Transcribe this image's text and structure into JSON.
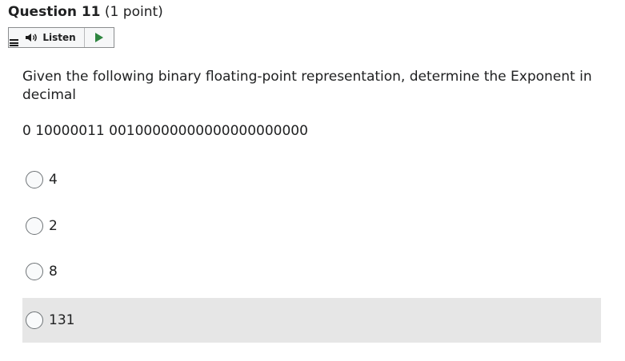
{
  "question": {
    "title": "Question 11",
    "points": "(1 point)",
    "text": "Given the following binary floating-point representation, determine the Exponent in decimal",
    "binary": "0 10000011 00100000000000000000000"
  },
  "listen": {
    "label": "Listen"
  },
  "options": [
    {
      "label": "4"
    },
    {
      "label": "2"
    },
    {
      "label": "8"
    },
    {
      "label": "131"
    }
  ],
  "colors": {
    "play_icon": "#2e8540",
    "shaded_row": "#e6e6e6"
  }
}
